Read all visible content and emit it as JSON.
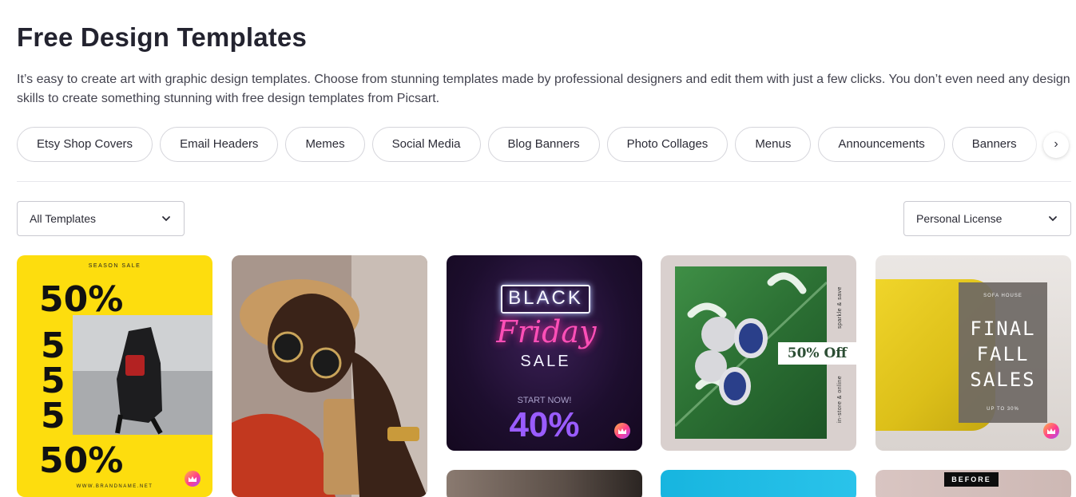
{
  "page": {
    "title": "Free Design Templates",
    "intro": "It’s easy to create art with graphic design templates. Choose from stunning templates made by professional designers and edit them with just a few clicks. You don’t even need any design skills to create something stunning with free design templates from Picsart."
  },
  "categories": [
    "Etsy Shop Covers",
    "Email Headers",
    "Memes",
    "Social Media",
    "Blog Banners",
    "Photo Collages",
    "Menus",
    "Announcements",
    "Banners"
  ],
  "filters": {
    "templates_value": "All Templates",
    "license_value": "Personal License"
  },
  "cards": {
    "season_sale": {
      "tag": "SEASON SALE",
      "line1": "50%",
      "lines": [
        "5",
        "5",
        "5"
      ],
      "line_last": "50%",
      "brand": "WWW.BRANDNAME.NET"
    },
    "black_friday": {
      "black": "BLACK",
      "friday": "Friday",
      "sale": "SALE",
      "start": "START NOW!",
      "percent": "40%"
    },
    "earrings": {
      "offer": "50% Off",
      "side_top": "sparkle & save",
      "side_bottom": "in-store & online"
    },
    "sofa": {
      "house": "SOFA HOUSE",
      "headline_lines": [
        "FINAL",
        "FALL",
        "SALES"
      ],
      "upto": "UP TO 30%"
    },
    "before_after": {
      "label": "BEFORE"
    }
  },
  "icons": {
    "chevron_down": "chevron-down-icon",
    "chevron_right": "chevron-right-icon",
    "premium_crown": "crown-icon"
  }
}
